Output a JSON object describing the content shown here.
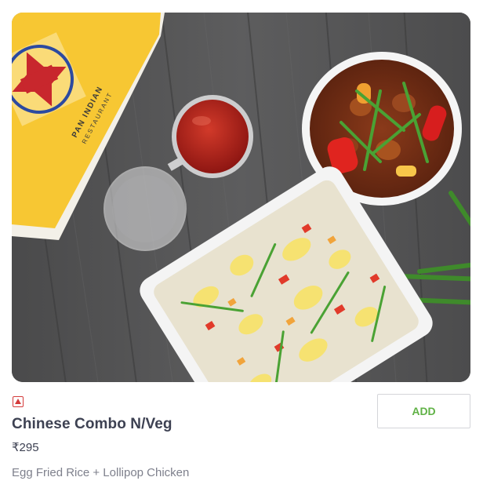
{
  "item": {
    "veg_indicator": "non-veg-icon",
    "name": "Chinese Combo N/Veg",
    "price": "₹295",
    "description": "Egg Fried Rice + Lollipop Chicken",
    "add_label": "ADD",
    "photo_icon": "food-photo",
    "bag_text_line1": "PAN INDIAN",
    "bag_text_line2": "RESTAURANT"
  },
  "colors": {
    "nonveg_red": "#d43b3b",
    "add_green": "#60b246",
    "title_text": "#3d4152",
    "desc_text": "#7e808c",
    "button_border": "#d4d5d9"
  }
}
